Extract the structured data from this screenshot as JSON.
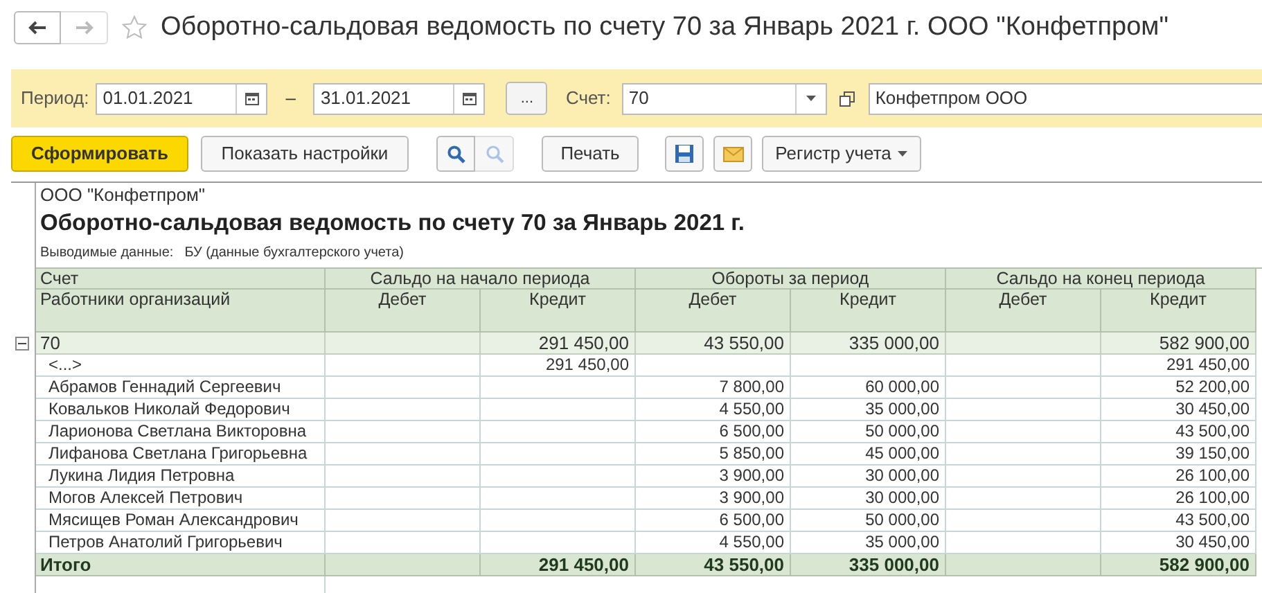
{
  "window": {
    "title": "Оборотно-сальдовая ведомость по счету 70 за Январь 2021 г. ООО \"Конфетпром\"",
    "favorite": false
  },
  "filter": {
    "period_label": "Период:",
    "date_from": "01.01.2021",
    "dash": "–",
    "date_to": "31.01.2021",
    "more_button": "...",
    "account_label": "Счет:",
    "account": "70",
    "organization": "Конфетпром ООО"
  },
  "toolbar": {
    "generate": "Сформировать",
    "settings": "Показать настройки",
    "print": "Печать",
    "register": "Регистр учета"
  },
  "report": {
    "organization": "ООО \"Конфетпром\"",
    "title": "Оборотно-сальдовая ведомость по счету 70 за Январь 2021 г.",
    "output_label": "Выводимые данные:",
    "output_value": "БУ (данные бухгалтерского учета)",
    "header": {
      "account": "Счет",
      "analytics": "Работники организаций",
      "groups": [
        "Сальдо на начало периода",
        "Обороты за период",
        "Сальдо на конец периода"
      ],
      "columns": [
        "Дебет",
        "Кредит",
        "Дебет",
        "Кредит",
        "Дебет",
        "Кредит"
      ]
    },
    "group_expanded": true,
    "rows": [
      {
        "kind": "group",
        "name": "70",
        "opening_credit": "291 450,00",
        "turnover_debit": "43 550,00",
        "turnover_credit": "335 000,00",
        "closing_credit": "582 900,00"
      },
      {
        "kind": "detail",
        "name": "<...>",
        "opening_credit": "291 450,00",
        "closing_credit": "291 450,00"
      },
      {
        "kind": "detail",
        "name": "Абрамов Геннадий Сергеевич",
        "turnover_debit": "7 800,00",
        "turnover_credit": "60 000,00",
        "closing_credit": "52 200,00"
      },
      {
        "kind": "detail",
        "name": "Ковальков Николай Федорович",
        "turnover_debit": "4 550,00",
        "turnover_credit": "35 000,00",
        "closing_credit": "30 450,00"
      },
      {
        "kind": "detail",
        "name": "Ларионова Светлана Викторовна",
        "turnover_debit": "6 500,00",
        "turnover_credit": "50 000,00",
        "closing_credit": "43 500,00"
      },
      {
        "kind": "detail",
        "name": "Лифанова Светлана Григорьевна",
        "turnover_debit": "5 850,00",
        "turnover_credit": "45 000,00",
        "closing_credit": "39 150,00"
      },
      {
        "kind": "detail",
        "name": "Лукина Лидия Петровна",
        "turnover_debit": "3 900,00",
        "turnover_credit": "30 000,00",
        "closing_credit": "26 100,00"
      },
      {
        "kind": "detail",
        "name": "Могов Алексей Петрович",
        "turnover_debit": "3 900,00",
        "turnover_credit": "30 000,00",
        "closing_credit": "26 100,00"
      },
      {
        "kind": "detail",
        "name": "Мясищев Роман Александрович",
        "turnover_debit": "6 500,00",
        "turnover_credit": "50 000,00",
        "closing_credit": "43 500,00"
      },
      {
        "kind": "detail",
        "name": "Петров Анатолий Григорьевич",
        "turnover_debit": "4 550,00",
        "turnover_credit": "35 000,00",
        "closing_credit": "30 450,00"
      },
      {
        "kind": "total",
        "name": "Итого",
        "opening_credit": "291 450,00",
        "turnover_debit": "43 550,00",
        "turnover_credit": "335 000,00",
        "closing_credit": "582 900,00"
      }
    ]
  }
}
